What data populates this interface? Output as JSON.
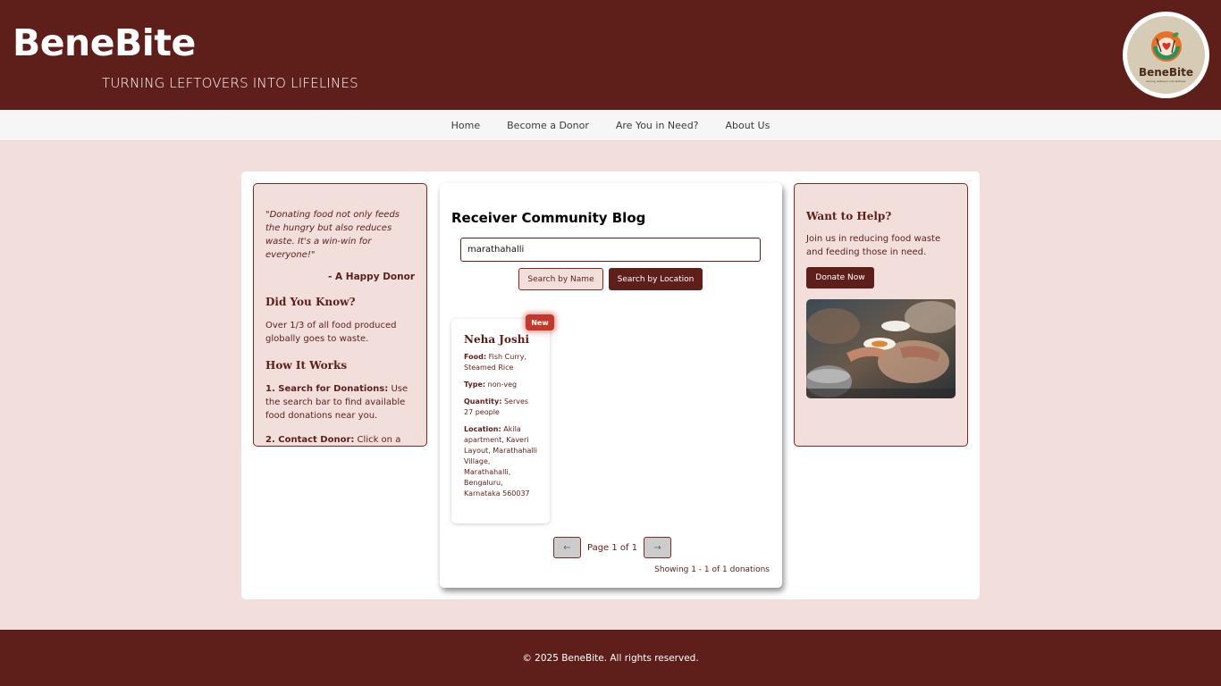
{
  "header": {
    "brand": "BeneBite",
    "tagline": "TURNING LEFTOVERS INTO LIFELINES",
    "logo_text": "BeneBite",
    "logo_sub": "turning leftovers into lifelines"
  },
  "nav": {
    "items": [
      "Home",
      "Become a Donor",
      "Are You in Need?",
      "About Us"
    ]
  },
  "left": {
    "quote": "\"Donating food not only feeds the hungry but also reduces waste. It's a win-win for everyone!\"",
    "quote_author": "- A Happy Donor",
    "did_you_know_title": "Did You Know?",
    "did_you_know_text": "Over 1/3 of all food produced globally goes to waste.",
    "how_title": "How It Works",
    "step1_label": "1. Search for Donations:",
    "step1_text": " Use the search bar to find available food donations near you.",
    "step2_label": "2. Contact Donor:",
    "step2_text": " Click on a donation to view details and enjoy"
  },
  "blog": {
    "title": "Receiver Community Blog",
    "search_value": "marathahalli",
    "btn_name": "Search by Name",
    "btn_location": "Search by Location",
    "card": {
      "badge": "New",
      "name": "Neha Joshi",
      "food_label": "Food:",
      "food": " Fish Curry, Steamed Rice",
      "type_label": "Type:",
      "type": " non-veg",
      "quantity_label": "Quantity:",
      "quantity": " Serves 27 people",
      "location_label": "Location:",
      "location": " Akila apartment, Kaveri Layout, Marathahalli Village, Marathahalli, Bengaluru, Karnataka 560037"
    },
    "prev": "←",
    "next": "→",
    "page_label": "Page 1 of 1",
    "showing": "Showing 1 - 1 of 1 donations"
  },
  "right": {
    "title": "Want to Help?",
    "text": "Join us in reducing food waste and feeding those in need.",
    "button": "Donate Now"
  },
  "footer": {
    "text": "© 2025 BeneBite. All rights reserved."
  },
  "colors": {
    "primary": "#5e1f1a",
    "panel_bg": "#f2dedb",
    "badge": "#c0392b"
  }
}
